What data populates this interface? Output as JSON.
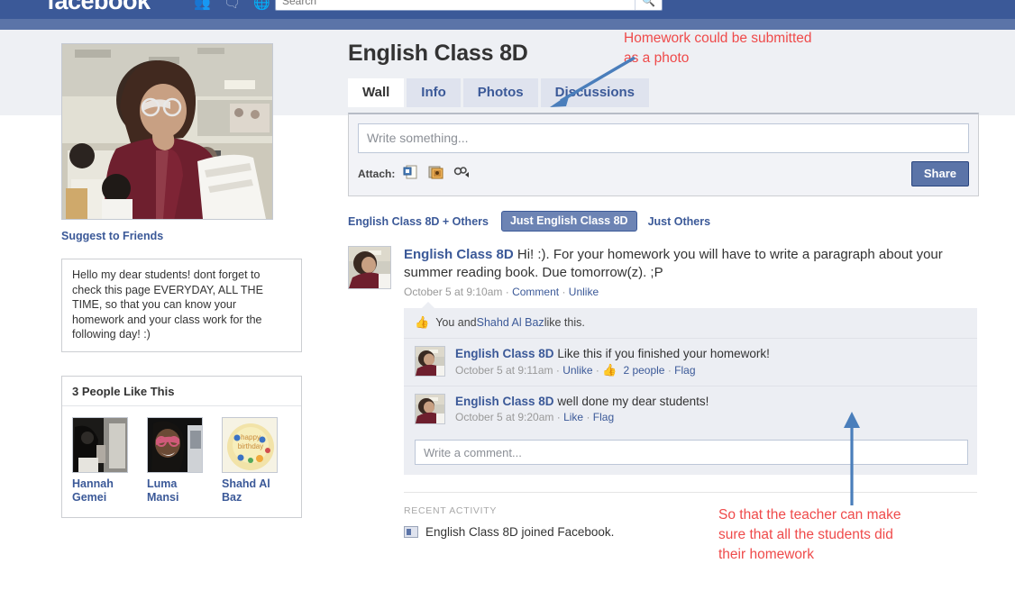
{
  "chrome": {
    "brand": "facebook",
    "icons": [
      "friends-icon",
      "messages-icon",
      "notifications-icon"
    ],
    "search_placeholder": "Search",
    "search_value": "",
    "search_button_icon": "search-icon",
    "bar_color": "#3b5998",
    "bar_color_light": "#5b74a8"
  },
  "sidebar": {
    "profile_photo_alt": "teacher with glasses holding papers in a classroom",
    "suggest_link": "Suggest to Friends",
    "about_text": "Hello my dear students! dont forget to check this page EVERYDAY, ALL THE TIME, so that you can know your homework and your class work for the following day! :)",
    "likes_title": "3 People Like This",
    "fans": [
      {
        "name": "Hannah Gemei",
        "thumb": "dark-photo-with-person"
      },
      {
        "name": "Luma Mansi",
        "thumb": "girl-with-glasses-photo"
      },
      {
        "name": "Shahd Al Baz",
        "thumb": "happy-birthday-cake-photo"
      }
    ]
  },
  "main": {
    "page_title": "English Class 8D",
    "tabs": [
      {
        "label": "Wall",
        "active": true
      },
      {
        "label": "Info",
        "active": false
      },
      {
        "label": "Photos",
        "active": false
      },
      {
        "label": "Discussions",
        "active": false
      }
    ],
    "composer": {
      "placeholder": "Write something...",
      "value": "",
      "attach_label": "Attach:",
      "attach_icons": [
        "link-icon",
        "photo-icon",
        "video-icon"
      ],
      "share_label": "Share"
    },
    "filters": [
      {
        "label": "English Class 8D + Others",
        "active": false
      },
      {
        "label": "Just English Class 8D",
        "active": true
      },
      {
        "label": "Just Others",
        "active": false
      }
    ],
    "story": {
      "author": "English Class 8D",
      "text": "Hi! :). For your homework you will have to write a paragraph about your summer reading book. Due tomorrow(z). ;P",
      "time": "October 5 at 9:10am",
      "actions": [
        "Comment",
        "Unlike"
      ],
      "likes_text_prefix": "You and ",
      "likes_name": "Shahd Al Baz",
      "likes_text_suffix": " like this."
    },
    "comments": [
      {
        "author": "English Class 8D",
        "text": "Like this if you finished your homework!",
        "time": "October 5 at 9:11am",
        "action1": "Unlike",
        "likes_count": "2 people",
        "action2": "Flag"
      },
      {
        "author": "English Class 8D",
        "text": "well done my dear students!",
        "time": "October 5 at 9:20am",
        "action1": "Like",
        "likes_count": "",
        "action2": "Flag"
      }
    ],
    "comment_placeholder": "Write a comment...",
    "comment_value": "",
    "recent_activity": {
      "title": "RECENT ACTIVITY",
      "item": "English Class 8D joined Facebook."
    }
  },
  "annotations": {
    "color": "#ef4a4a",
    "arrow_color": "#4a7ebb",
    "photo_note_line1": "Homework could be submitted",
    "photo_note_line2": "as a photo",
    "teacher_note_line1": "So that the teacher can make",
    "teacher_note_line2": "sure that all the students did",
    "teacher_note_line3": "their homework"
  }
}
